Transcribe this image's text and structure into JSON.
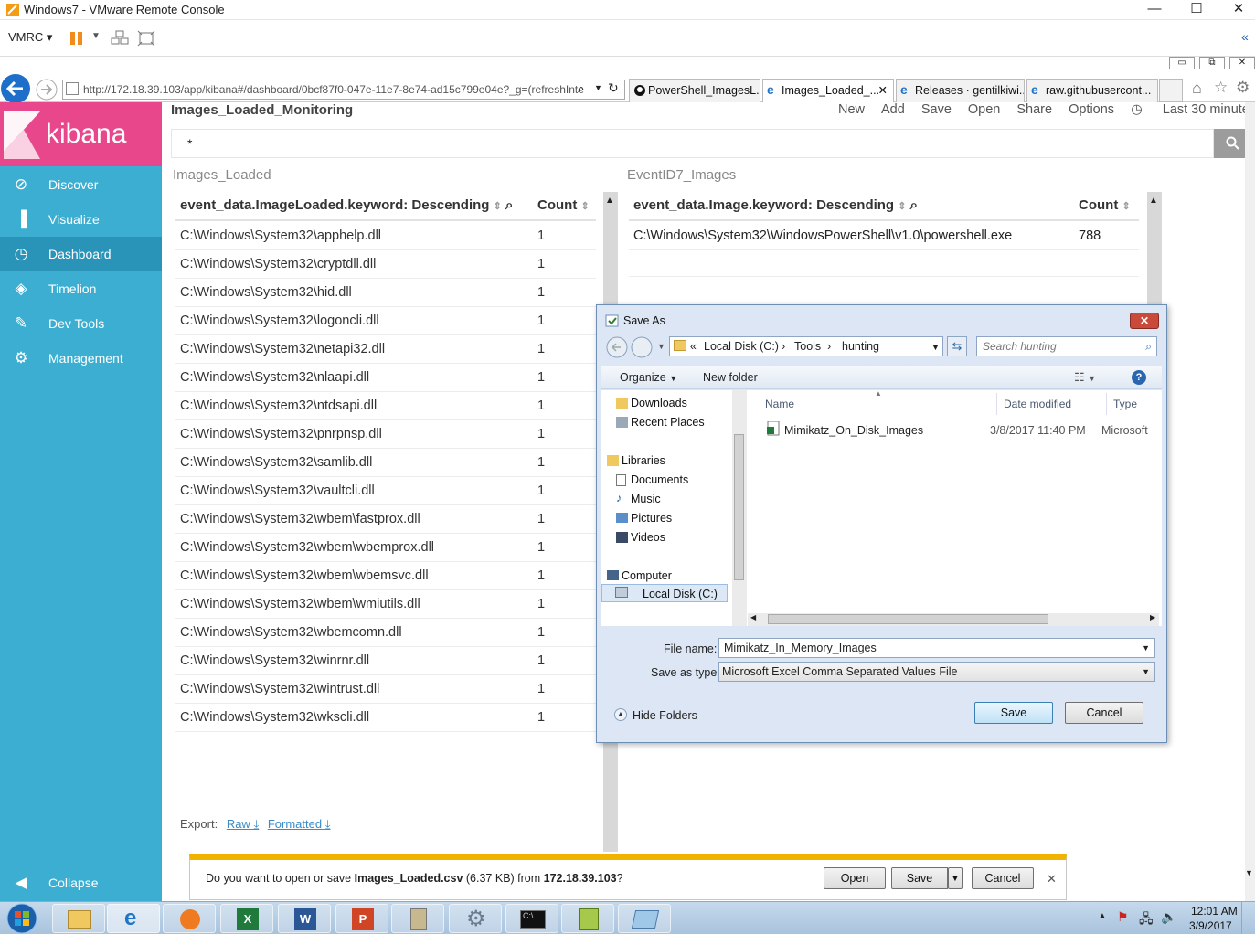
{
  "vmrc": {
    "title": "Windows7 - VMware Remote Console",
    "menu": "VMRC",
    "minimize": "—",
    "maximize": "☐",
    "close": "✕"
  },
  "ie": {
    "url": "http://172.18.39.103/app/kibana#/dashboard/0bcf87f0-047e-11e7-8e74-ad15c799e04e?_g=(refreshInte",
    "tabs": [
      {
        "label": "PowerShell_ImagesL..."
      },
      {
        "label": "Images_Loaded_..."
      },
      {
        "label": "Releases · gentilkiwi..."
      },
      {
        "label": "raw.githubusercont..."
      }
    ]
  },
  "kibana": {
    "logo": "kibana",
    "nav": [
      {
        "label": "Discover",
        "icon": "compass-icon"
      },
      {
        "label": "Visualize",
        "icon": "bar-chart-icon"
      },
      {
        "label": "Dashboard",
        "icon": "dashboard-icon"
      },
      {
        "label": "Timelion",
        "icon": "timelion-icon"
      },
      {
        "label": "Dev Tools",
        "icon": "wrench-icon"
      },
      {
        "label": "Management",
        "icon": "gear-icon"
      }
    ],
    "collapse": "Collapse",
    "dashboard_title": "Images_Loaded_Monitoring",
    "top_nav": [
      "New",
      "Add",
      "Save",
      "Open",
      "Share",
      "Options"
    ],
    "time": "Last 30 minutes",
    "query": "*",
    "panel1": {
      "title": "Images_Loaded",
      "col1": "event_data.ImageLoaded.keyword: Descending",
      "col2": "Count",
      "rows": [
        {
          "name": "C:\\Windows\\System32\\apphelp.dll",
          "count": "1"
        },
        {
          "name": "C:\\Windows\\System32\\cryptdll.dll",
          "count": "1"
        },
        {
          "name": "C:\\Windows\\System32\\hid.dll",
          "count": "1"
        },
        {
          "name": "C:\\Windows\\System32\\logoncli.dll",
          "count": "1"
        },
        {
          "name": "C:\\Windows\\System32\\netapi32.dll",
          "count": "1"
        },
        {
          "name": "C:\\Windows\\System32\\nlaapi.dll",
          "count": "1"
        },
        {
          "name": "C:\\Windows\\System32\\ntdsapi.dll",
          "count": "1"
        },
        {
          "name": "C:\\Windows\\System32\\pnrpnsp.dll",
          "count": "1"
        },
        {
          "name": "C:\\Windows\\System32\\samlib.dll",
          "count": "1"
        },
        {
          "name": "C:\\Windows\\System32\\vaultcli.dll",
          "count": "1"
        },
        {
          "name": "C:\\Windows\\System32\\wbem\\fastprox.dll",
          "count": "1"
        },
        {
          "name": "C:\\Windows\\System32\\wbem\\wbemprox.dll",
          "count": "1"
        },
        {
          "name": "C:\\Windows\\System32\\wbem\\wbemsvc.dll",
          "count": "1"
        },
        {
          "name": "C:\\Windows\\System32\\wbem\\wmiutils.dll",
          "count": "1"
        },
        {
          "name": "C:\\Windows\\System32\\wbemcomn.dll",
          "count": "1"
        },
        {
          "name": "C:\\Windows\\System32\\winrnr.dll",
          "count": "1"
        },
        {
          "name": "C:\\Windows\\System32\\wintrust.dll",
          "count": "1"
        },
        {
          "name": "C:\\Windows\\System32\\wkscli.dll",
          "count": "1"
        }
      ],
      "export_label": "Export:",
      "export_raw": "Raw",
      "export_formatted": "Formatted"
    },
    "panel2": {
      "title": "EventID7_Images",
      "col1": "event_data.Image.keyword: Descending",
      "col2": "Count",
      "rows": [
        {
          "name": "C:\\Windows\\System32\\WindowsPowerShell\\v1.0\\powershell.exe",
          "count": "788"
        }
      ]
    }
  },
  "save_dialog": {
    "title": "Save As",
    "crumb": [
      "«",
      "Local Disk (C:)",
      "Tools",
      "hunting"
    ],
    "search_placeholder": "Search hunting",
    "organize": "Organize",
    "new_folder": "New folder",
    "tree": [
      "Downloads",
      "Recent Places",
      "Libraries",
      "Documents",
      "Music",
      "Pictures",
      "Videos",
      "Computer",
      "Local Disk (C:)"
    ],
    "columns": [
      "Name",
      "Date modified",
      "Type"
    ],
    "files": [
      {
        "name": "Mimikatz_On_Disk_Images",
        "date": "3/8/2017 11:40 PM",
        "type": "Microsoft"
      }
    ],
    "file_name_label": "File name:",
    "file_name": "Mimikatz_In_Memory_Images",
    "save_type_label": "Save as type:",
    "save_type": "Microsoft Excel Comma Separated Values File",
    "hide_folders": "Hide Folders",
    "save": "Save",
    "cancel": "Cancel"
  },
  "download_bar": {
    "prompt_pre": "Do you want to open or save ",
    "file": "Images_Loaded.csv",
    "size": " (6.37 KB) from ",
    "host": "172.18.39.103",
    "q": "?",
    "open": "Open",
    "save": "Save",
    "cancel": "Cancel"
  },
  "taskbar": {
    "time": "12:01 AM",
    "date": "3/9/2017"
  }
}
